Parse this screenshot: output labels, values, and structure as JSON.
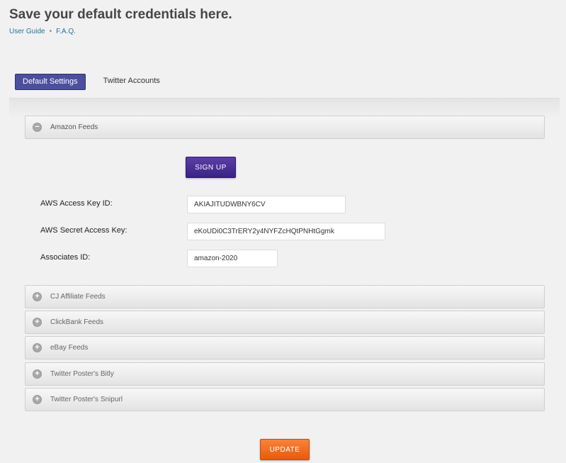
{
  "page": {
    "title": "Save your default credentials here.",
    "links": {
      "user_guide": "User Guide",
      "separator": "•",
      "faq": "F.A.Q."
    }
  },
  "tabs": [
    {
      "label": "Default Settings",
      "active": true
    },
    {
      "label": "Twitter Accounts",
      "active": false
    }
  ],
  "amazon": {
    "header": "Amazon Feeds",
    "toggle_symbol": "−",
    "signup_label": "SIGN UP",
    "fields": [
      {
        "label": "AWS Access Key ID:",
        "value": "AKIAJITUDWBNY6CV"
      },
      {
        "label": "AWS Secret Access Key:",
        "value": "eKoUDi0C3TrERY2y4NYFZcHQtPNHtGgmk"
      },
      {
        "label": "Associates ID:",
        "value": "amazon-2020"
      }
    ]
  },
  "collapsed_sections": [
    {
      "label": "CJ Affiliate Feeds",
      "toggle_symbol": "+"
    },
    {
      "label": "ClickBank Feeds",
      "toggle_symbol": "+"
    },
    {
      "label": "eBay Feeds",
      "toggle_symbol": "+"
    },
    {
      "label": "Twitter Poster's Bitly",
      "toggle_symbol": "+"
    },
    {
      "label": "Twitter Poster's Snipurl",
      "toggle_symbol": "+"
    }
  ],
  "actions": {
    "update_label": "UPDATE"
  },
  "colors": {
    "tab_active": "#4b4f9e",
    "signup_button": "#4a2f96",
    "update_button": "#f06a1f",
    "link": "#21759b"
  }
}
